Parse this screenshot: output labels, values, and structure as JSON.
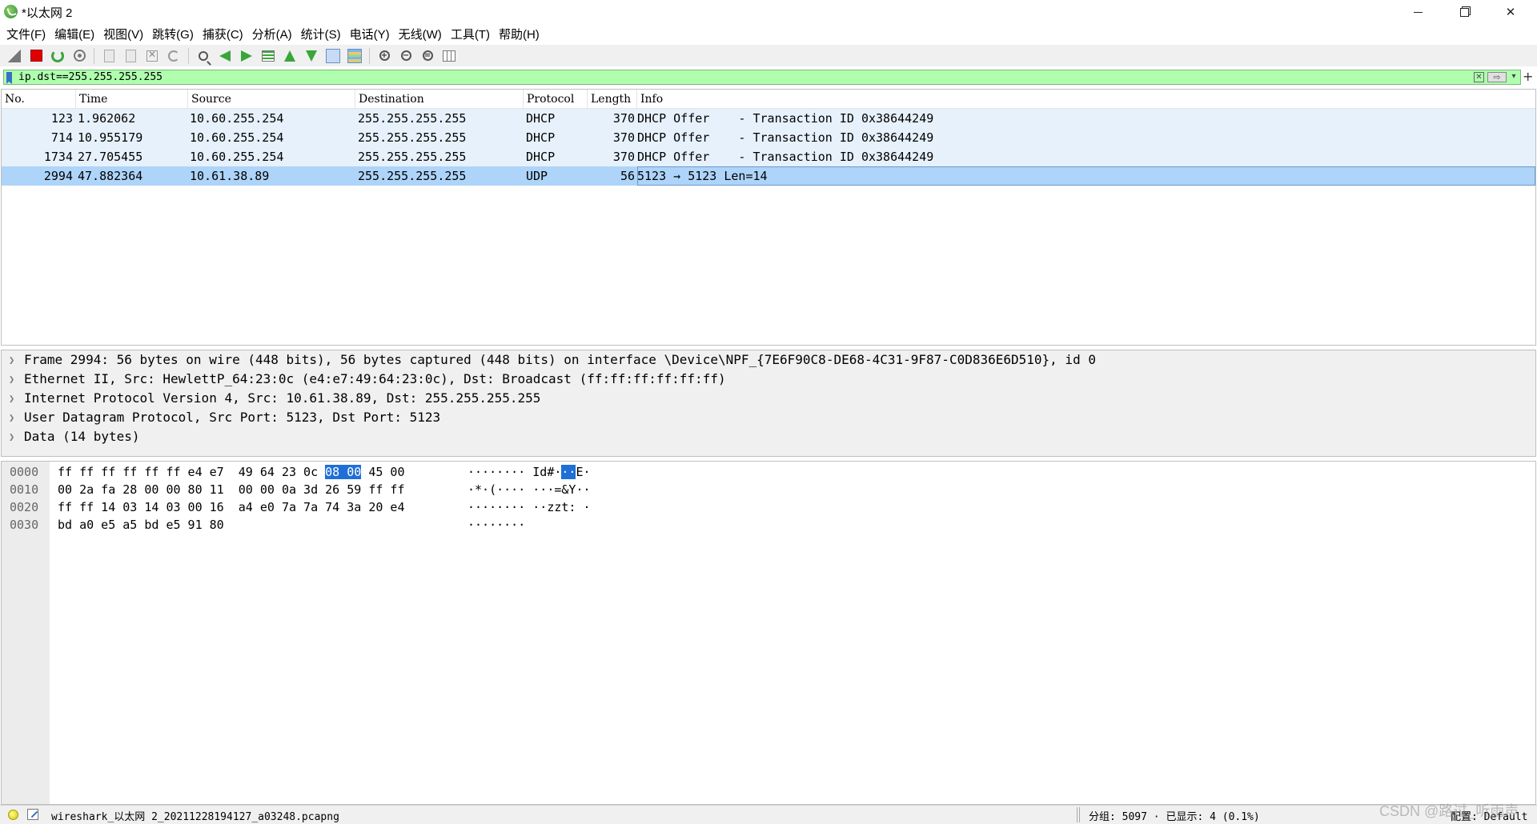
{
  "window": {
    "title": "*以太网 2"
  },
  "menu": [
    "文件(F)",
    "编辑(E)",
    "视图(V)",
    "跳转(G)",
    "捕获(C)",
    "分析(A)",
    "统计(S)",
    "电话(Y)",
    "无线(W)",
    "工具(T)",
    "帮助(H)"
  ],
  "toolbar": {
    "icons": [
      "start-capture-icon",
      "stop-capture-icon",
      "restart-capture-icon",
      "capture-options-icon",
      "open-file-icon",
      "save-file-icon",
      "close-file-icon",
      "reload-file-icon",
      "find-packet-icon",
      "go-back-icon",
      "go-forward-icon",
      "go-to-packet-icon",
      "first-packet-icon",
      "last-packet-icon",
      "auto-scroll-icon",
      "colorize-icon",
      "zoom-in-icon",
      "zoom-out-icon",
      "zoom-reset-icon",
      "resize-columns-icon"
    ]
  },
  "filter": {
    "value": "ip.dst==255.255.255.255"
  },
  "packet_list": {
    "columns": [
      "No.",
      "Time",
      "Source",
      "Destination",
      "Protocol",
      "Length",
      "Info"
    ],
    "rows": [
      {
        "no": "123",
        "time": "1.962062",
        "source": "10.60.255.254",
        "destination": "255.255.255.255",
        "protocol": "DHCP",
        "length": "370",
        "info": "DHCP Offer    - Transaction ID 0x38644249"
      },
      {
        "no": "714",
        "time": "10.955179",
        "source": "10.60.255.254",
        "destination": "255.255.255.255",
        "protocol": "DHCP",
        "length": "370",
        "info": "DHCP Offer    - Transaction ID 0x38644249"
      },
      {
        "no": "1734",
        "time": "27.705455",
        "source": "10.60.255.254",
        "destination": "255.255.255.255",
        "protocol": "DHCP",
        "length": "370",
        "info": "DHCP Offer    - Transaction ID 0x38644249"
      },
      {
        "no": "2994",
        "time": "47.882364",
        "source": "10.61.38.89",
        "destination": "255.255.255.255",
        "protocol": "UDP",
        "length": "56",
        "info": "5123 → 5123 Len=14"
      }
    ]
  },
  "details": [
    "Frame 2994: 56 bytes on wire (448 bits), 56 bytes captured (448 bits) on interface \\Device\\NPF_{7E6F90C8-DE68-4C31-9F87-C0D836E6D510}, id 0",
    "Ethernet II, Src: HewlettP_64:23:0c (e4:e7:49:64:23:0c), Dst: Broadcast (ff:ff:ff:ff:ff:ff)",
    "Internet Protocol Version 4, Src: 10.61.38.89, Dst: 255.255.255.255",
    "User Datagram Protocol, Src Port: 5123, Dst Port: 5123",
    "Data (14 bytes)"
  ],
  "hex": [
    {
      "offset": "0000",
      "pre": "ff ff ff ff ff ff e4 e7  49 64 23 0c ",
      "hl": "08 00",
      "post": " 45 00",
      "ascii_pre": "········ Id#·",
      "ascii_hl": "··",
      "ascii_post": "E·"
    },
    {
      "offset": "0010",
      "pre": "00 2a fa 28 00 00 80 11  00 00 0a 3d 26 59 ff ff",
      "hl": "",
      "post": "",
      "ascii_pre": "·*·(···· ···=&Y··",
      "ascii_hl": "",
      "ascii_post": ""
    },
    {
      "offset": "0020",
      "pre": "ff ff 14 03 14 03 00 16  a4 e0 7a 7a 74 3a 20 e4",
      "hl": "",
      "post": "",
      "ascii_pre": "········ ··zzt: ·",
      "ascii_hl": "",
      "ascii_post": ""
    },
    {
      "offset": "0030",
      "pre": "bd a0 e5 a5 bd e5 91 80",
      "hl": "",
      "post": "",
      "ascii_pre": "········",
      "ascii_hl": "",
      "ascii_post": ""
    }
  ],
  "status": {
    "file": "wireshark_以太网 2_20211228194127_a03248.pcapng",
    "packets": "分组: 5097 · 已显示: 4 (0.1%)",
    "profile": "配置: Default"
  },
  "watermark": "CSDN @路过_听雨声",
  "colors": {
    "filter_valid_bg": "#afffaf",
    "row_bg": "#e7f1fc",
    "row_selected_bg": "#aed4f9",
    "hex_highlight": "#1f6fd6"
  }
}
